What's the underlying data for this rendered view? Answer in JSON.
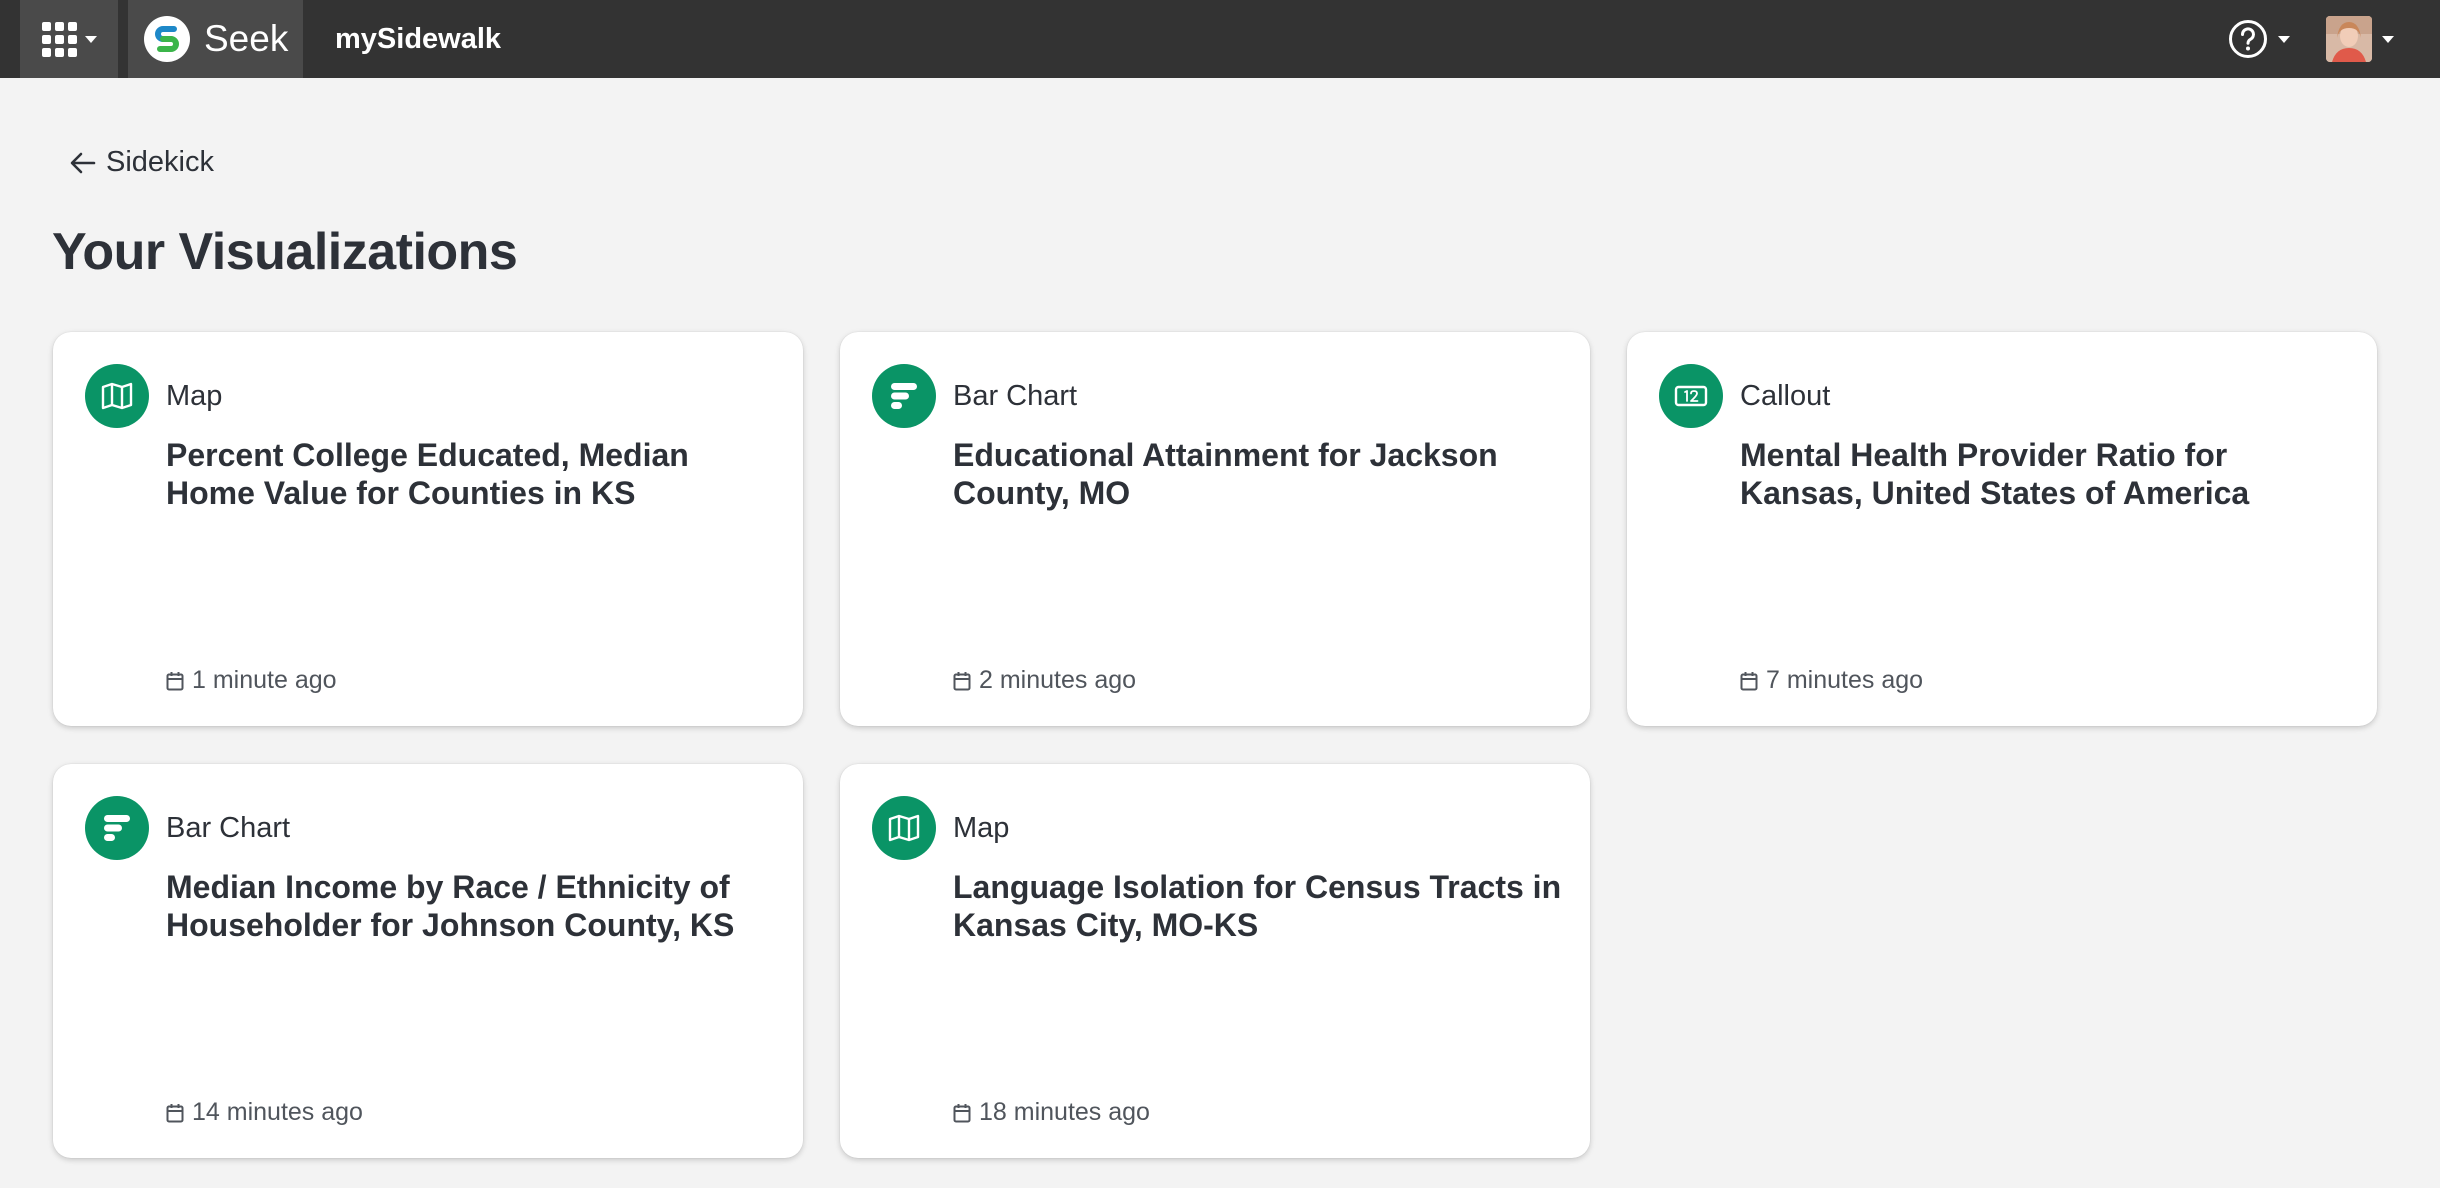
{
  "topbar": {
    "apps_icon": "grid-icon",
    "brand_name": "Seek",
    "org_name": "mySidewalk",
    "help_icon": "question-circle-icon",
    "user_icon": "avatar"
  },
  "back_link": {
    "label": "Sidekick",
    "icon": "arrow-left-icon"
  },
  "page_title": "Your Visualizations",
  "accent_color": "#0a9466",
  "cards": [
    {
      "type": "Map",
      "icon": "map-icon",
      "title": "Percent College Educated, Median Home Value for Counties in KS",
      "updated": "1 minute ago"
    },
    {
      "type": "Bar Chart",
      "icon": "bar-chart-icon",
      "title": "Educational Attainment for Jackson County, MO",
      "updated": "2 minutes ago"
    },
    {
      "type": "Callout",
      "icon": "callout-icon",
      "title": "Mental Health Provider Ratio for Kansas, United States of America",
      "updated": "7 minutes ago"
    },
    {
      "type": "Bar Chart",
      "icon": "bar-chart-icon",
      "title": "Median Income by Race / Ethnicity of Householder for Johnson County, KS",
      "updated": "14 minutes ago"
    },
    {
      "type": "Map",
      "icon": "map-icon",
      "title": "Language Isolation for Census Tracts in Kansas City, MO-KS",
      "updated": "18 minutes ago"
    }
  ]
}
